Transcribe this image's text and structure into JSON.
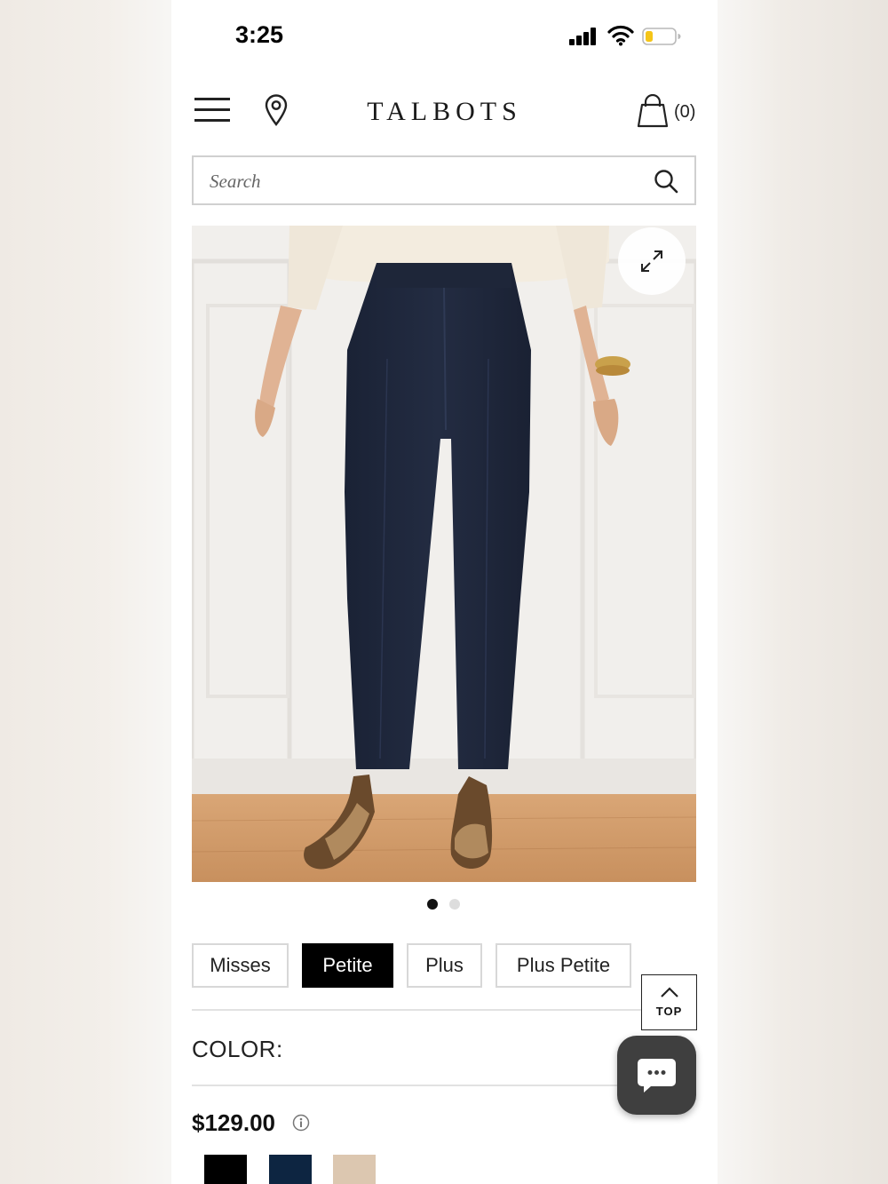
{
  "status_bar": {
    "time": "3:25",
    "signal_icon": "cellular-signal-icon",
    "wifi_icon": "wifi-icon",
    "battery_icon": "battery-low-icon",
    "battery_color": "#f5c518"
  },
  "header": {
    "logo": "TALBOTS",
    "cart_count": "(0)",
    "menu_icon": "hamburger-menu-icon",
    "location_icon": "location-pin-icon",
    "cart_icon": "shopping-bag-icon"
  },
  "search": {
    "placeholder": "Search",
    "icon": "search-icon"
  },
  "gallery": {
    "expand_icon": "expand-arrows-icon",
    "total_images": 2,
    "active_index": 0
  },
  "size_tabs": [
    {
      "label": "Misses",
      "active": false
    },
    {
      "label": "Petite",
      "active": true
    },
    {
      "label": "Plus",
      "active": false
    },
    {
      "label": "Plus Petite",
      "active": false
    }
  ],
  "color": {
    "label": "COLOR:"
  },
  "price": {
    "value": "$129.00",
    "info_icon": "info-circle-icon"
  },
  "swatches": [
    {
      "color": "#000000"
    },
    {
      "color": "#0d2541"
    },
    {
      "color": "#dcc7b0"
    }
  ],
  "back_to_top": {
    "label": "TOP",
    "icon": "chevron-up-icon"
  },
  "chat": {
    "icon": "chat-bubble-icon"
  }
}
